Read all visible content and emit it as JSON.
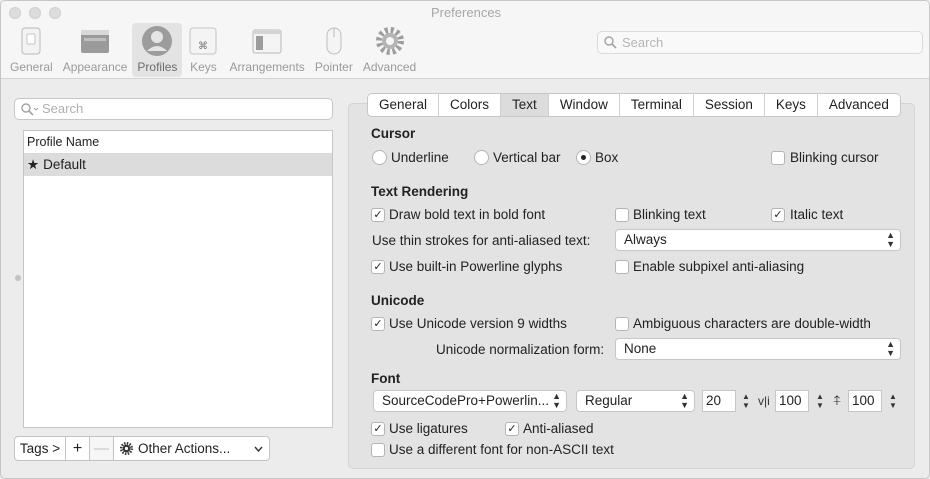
{
  "window": {
    "title": "Preferences"
  },
  "toolbar": {
    "items": [
      {
        "label": "General"
      },
      {
        "label": "Appearance"
      },
      {
        "label": "Profiles"
      },
      {
        "label": "Keys"
      },
      {
        "label": "Arrangements"
      },
      {
        "label": "Pointer"
      },
      {
        "label": "Advanced"
      }
    ],
    "active": "Profiles",
    "search_placeholder": "Search"
  },
  "left": {
    "search_placeholder": "Search",
    "column_header": "Profile Name",
    "profiles": [
      {
        "name": "Default",
        "default_marker": "★"
      }
    ],
    "tags_label": "Tags >",
    "add_label": "+",
    "remove_label": "—",
    "other_actions_label": "Other Actions..."
  },
  "tabs": [
    "General",
    "Colors",
    "Text",
    "Window",
    "Terminal",
    "Session",
    "Keys",
    "Advanced"
  ],
  "active_tab": "Text",
  "cursor": {
    "title": "Cursor",
    "underline": "Underline",
    "vertical_bar": "Vertical bar",
    "box": "Box",
    "selected": "Box",
    "blinking_cursor": "Blinking cursor",
    "blinking_cursor_checked": false
  },
  "text_rendering": {
    "title": "Text Rendering",
    "bold_in_bold_font": "Draw bold text in bold font",
    "bold_checked": true,
    "blinking_text": "Blinking text",
    "blinking_text_checked": false,
    "italic_text": "Italic text",
    "italic_checked": true,
    "thin_strokes_label": "Use thin strokes for anti-aliased text:",
    "thin_strokes_value": "Always",
    "powerline": "Use built-in Powerline glyphs",
    "powerline_checked": true,
    "subpixel": "Enable subpixel anti-aliasing",
    "subpixel_checked": false
  },
  "unicode": {
    "title": "Unicode",
    "v9_widths": "Use Unicode version 9 widths",
    "v9_checked": true,
    "ambiguous": "Ambiguous characters are double-width",
    "ambiguous_checked": false,
    "normalization_label": "Unicode normalization form:",
    "normalization_value": "None"
  },
  "font": {
    "title": "Font",
    "family": "SourceCodePro+Powerlin...",
    "style": "Regular",
    "size": "20",
    "h_spacing_icon": "v|i",
    "h_spacing": "100",
    "v_spacing_icon": "⍏",
    "v_spacing": "100",
    "ligatures": "Use ligatures",
    "ligatures_checked": true,
    "anti_aliased": "Anti-aliased",
    "anti_aliased_checked": true,
    "non_ascii_font": "Use a different font for non-ASCII text",
    "non_ascii_checked": false
  }
}
